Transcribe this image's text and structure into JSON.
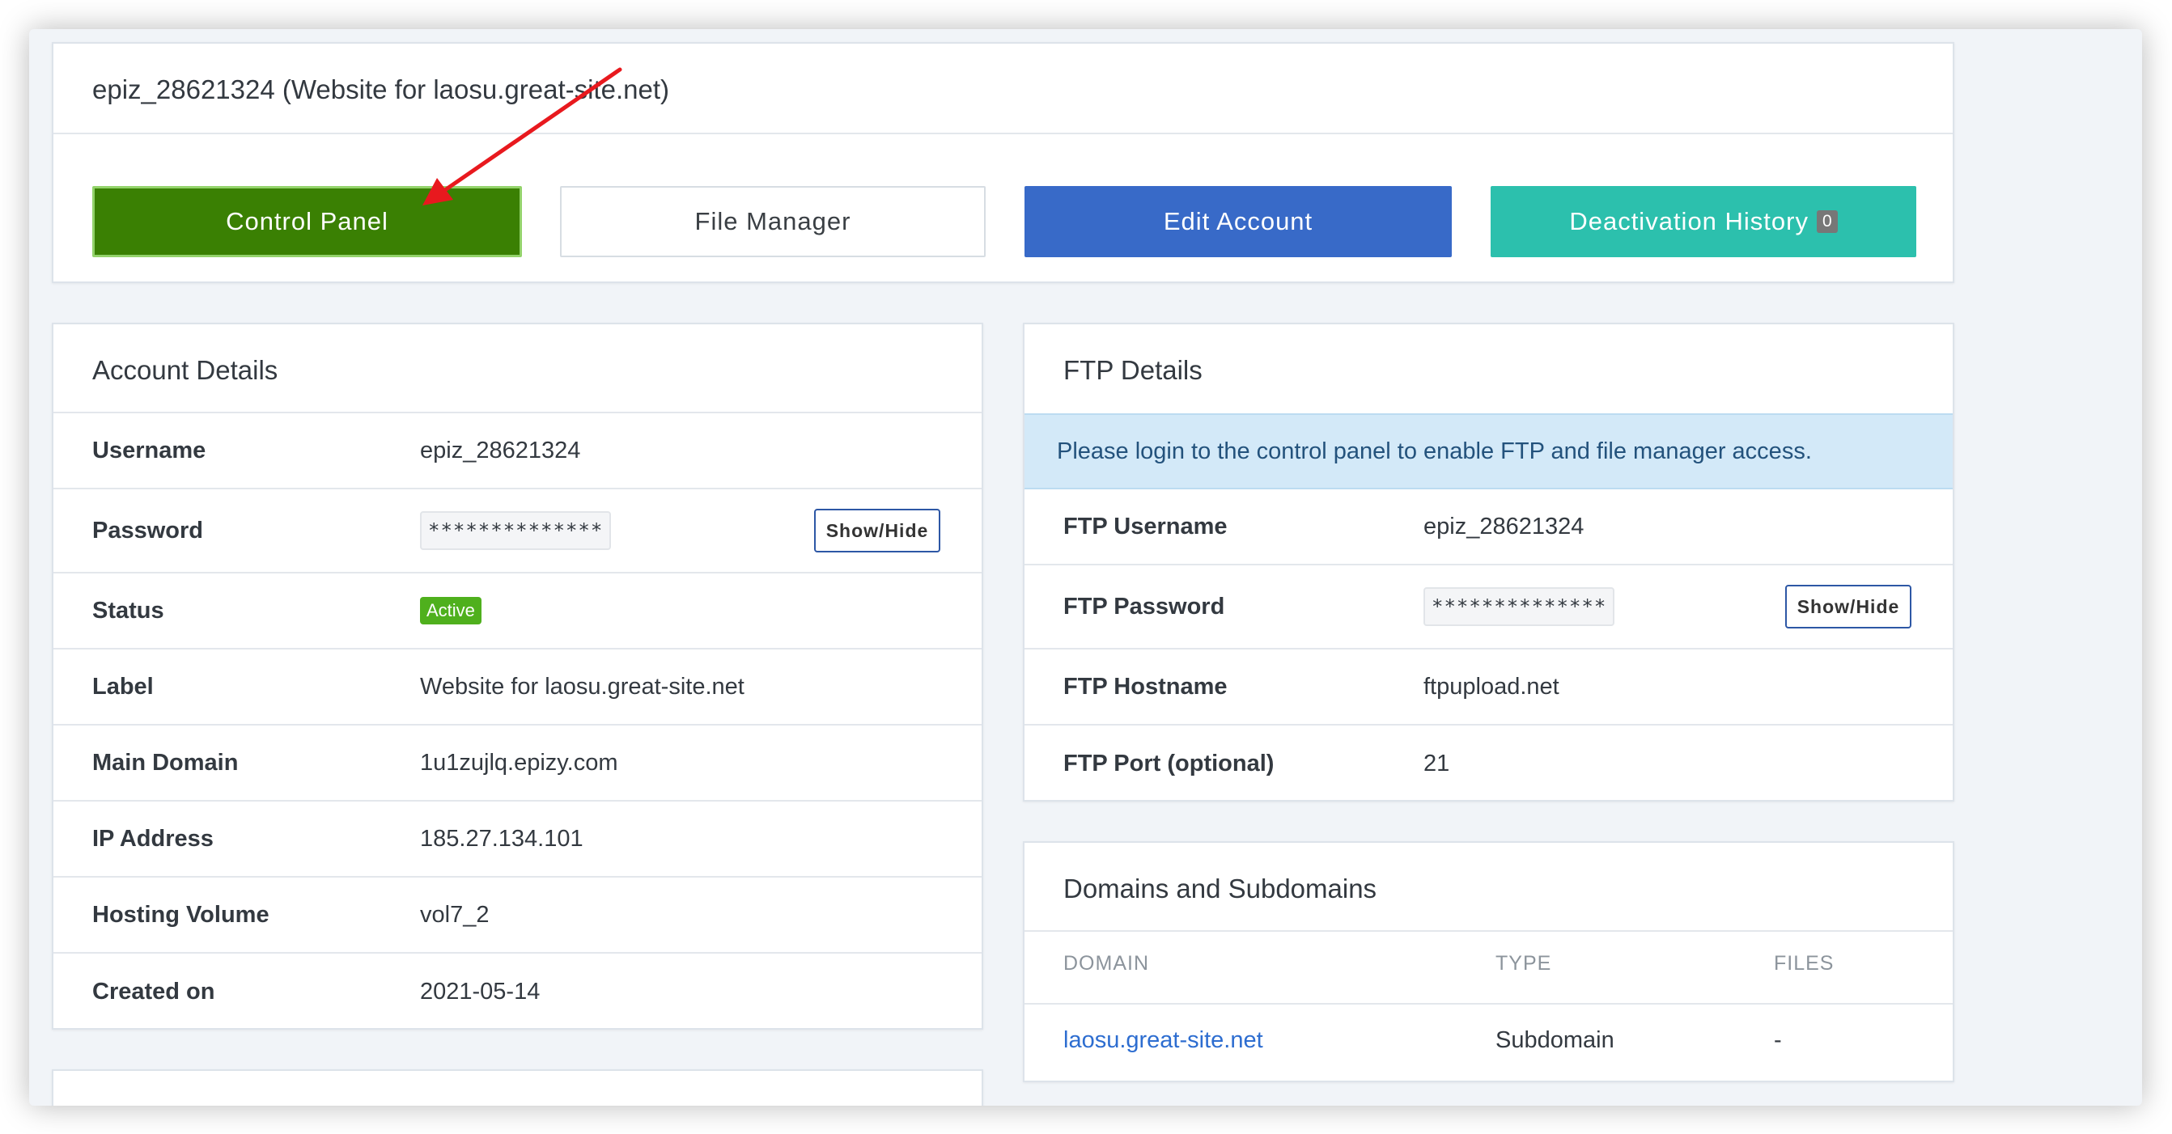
{
  "header": {
    "title": "epiz_28621324 (Website for laosu.great-site.net)"
  },
  "actions": {
    "control_panel": "Control Panel",
    "file_manager": "File Manager",
    "edit_account": "Edit Account",
    "deactivation_history": "Deactivation History",
    "deactivation_count": "0"
  },
  "account": {
    "title": "Account Details",
    "rows": [
      {
        "label": "Username",
        "value": "epiz_28621324"
      },
      {
        "label": "Password",
        "value": "**************"
      },
      {
        "label": "Status",
        "value": "Active"
      },
      {
        "label": "Label",
        "value": "Website for laosu.great-site.net"
      },
      {
        "label": "Main Domain",
        "value": "1u1zujlq.epizy.com"
      },
      {
        "label": "IP Address",
        "value": "185.27.134.101"
      },
      {
        "label": "Hosting Volume",
        "value": "vol7_2"
      },
      {
        "label": "Created on",
        "value": "2021-05-14"
      }
    ],
    "show_hide": "Show/Hide"
  },
  "ftp": {
    "title": "FTP Details",
    "notice": "Please login to the control panel to enable FTP and file manager access.",
    "rows": [
      {
        "label": "FTP Username",
        "value": "epiz_28621324"
      },
      {
        "label": "FTP Password",
        "value": "**************"
      },
      {
        "label": "FTP Hostname",
        "value": "ftpupload.net"
      },
      {
        "label": "FTP Port (optional)",
        "value": "21"
      }
    ],
    "show_hide": "Show/Hide"
  },
  "domains": {
    "title": "Domains and Subdomains",
    "columns": [
      "DOMAIN",
      "TYPE",
      "FILES"
    ],
    "rows": [
      {
        "domain": "laosu.great-site.net",
        "type": "Subdomain",
        "files": "-"
      }
    ]
  },
  "colors": {
    "control_panel": "#3a8003",
    "edit_account": "#386ac8",
    "deactivation_history": "#2cc0ad",
    "status_active": "#4fb01d",
    "annotation_arrow": "#e8191e"
  }
}
